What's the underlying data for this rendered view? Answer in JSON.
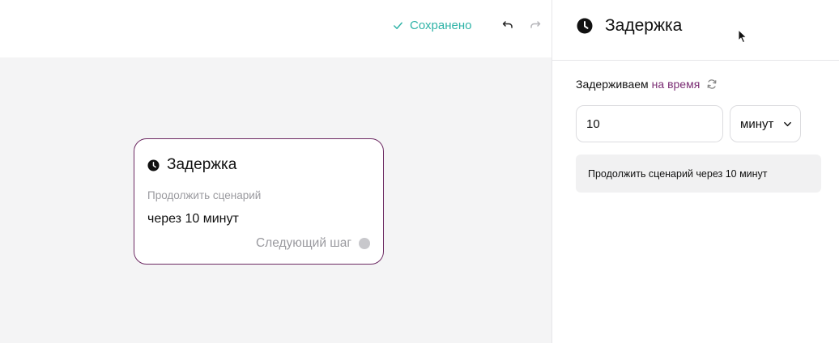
{
  "toolbar": {
    "saved_label": "Сохранено",
    "undo_icon": "undo-icon",
    "redo_icon": "redo-icon"
  },
  "node": {
    "title": "Задержка",
    "subtitle": "Продолжить сценарий",
    "value": "через 10 минут",
    "next_label": "Следующий шаг",
    "icon": "clock-icon"
  },
  "panel": {
    "title": "Задержка",
    "icon": "clock-icon",
    "delay_label": "Задерживаем",
    "delay_mode": "на время",
    "amount": "10",
    "unit": "минут",
    "summary": "Продолжить сценарий через 10 минут"
  },
  "colors": {
    "accent": "#6d2a63",
    "link": "#7b2d74",
    "saved": "#2fb3a7",
    "canvas": "#f4f4f5"
  }
}
